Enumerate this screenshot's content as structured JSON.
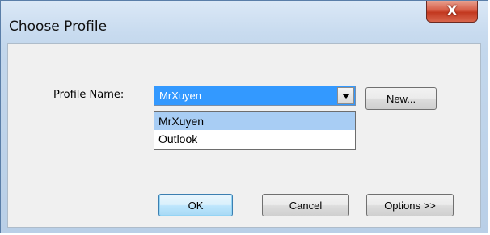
{
  "window": {
    "title": "Choose Profile",
    "close_glyph": "X"
  },
  "form": {
    "profile_label": "Profile Name:",
    "profile_value": "MrXuyen",
    "dropdown_options": [
      {
        "label": "MrXuyen",
        "selected": true
      },
      {
        "label": "Outlook",
        "selected": false
      }
    ]
  },
  "buttons": {
    "new": "New...",
    "ok": "OK",
    "cancel": "Cancel",
    "options": "Options >>"
  },
  "icons": {
    "close": "close-icon",
    "dropdown": "chevron-down-icon"
  },
  "colors": {
    "selection": "#3399ff",
    "hover_item": "#a8cdf4",
    "close_red": "#c2381f"
  }
}
